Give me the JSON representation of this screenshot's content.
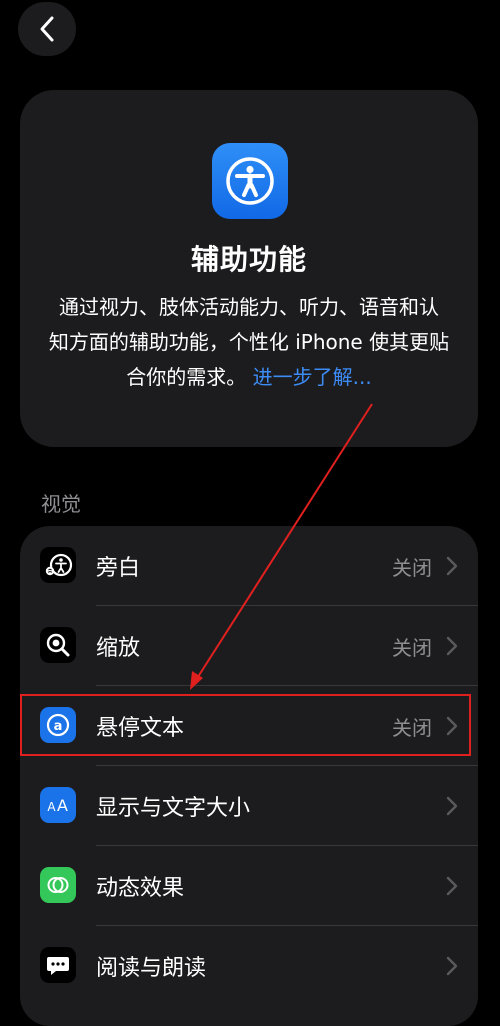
{
  "nav": {
    "back_label": "Back"
  },
  "header": {
    "icon": "accessibility-figure-icon",
    "title": "辅助功能",
    "description_lines": [
      "通过视力、肢体活动能力、听力、语音和认",
      "知方面的辅助功能，个性化 iPhone 使其更贴",
      "合你的需求。"
    ],
    "learn_more": "进一步了解..."
  },
  "section": {
    "title": "视觉"
  },
  "rows": [
    {
      "label": "旁白",
      "value": "关闭",
      "icon": "voiceover-icon"
    },
    {
      "label": "缩放",
      "value": "关闭",
      "icon": "zoom-icon"
    },
    {
      "label": "悬停文本",
      "value": "关闭",
      "icon": "hover-text-icon"
    },
    {
      "label": "显示与文字大小",
      "value": "",
      "icon": "display-text-size-icon"
    },
    {
      "label": "动态效果",
      "value": "",
      "icon": "motion-icon"
    },
    {
      "label": "阅读与朗读",
      "value": "",
      "icon": "spoken-content-icon"
    }
  ],
  "colors": {
    "background": "#000000",
    "card": "#1c1c1e",
    "link": "#3d8cf5",
    "secondary_text": "#8e8e93",
    "highlight_annotation": "#e0201f",
    "icon_blue": "#1a73e8",
    "icon_green": "#34c759"
  }
}
